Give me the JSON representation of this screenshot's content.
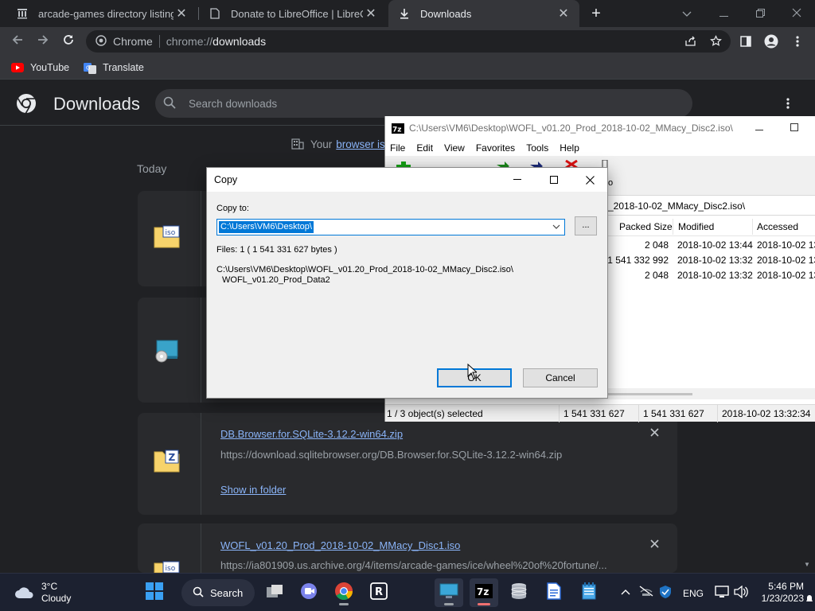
{
  "browser": {
    "tabs": [
      {
        "title": "arcade-games directory listing",
        "close": "✕"
      },
      {
        "title": "Donate to LibreOffice | LibreOffice",
        "close": "✕"
      },
      {
        "title": "Downloads",
        "close": "✕"
      }
    ],
    "new_tab": "+",
    "site_chip": "Chrome",
    "url_scheme": "chrome://",
    "url_host": "downloads",
    "bookmarks": [
      {
        "label": "YouTube"
      },
      {
        "label": "Translate"
      }
    ]
  },
  "downloads_page": {
    "title": "Downloads",
    "search_placeholder": "Search downloads",
    "managed_prefix": "Your",
    "managed_link": "browser is",
    "date_heading": "Today",
    "items": [
      {
        "name": "DB.Browser.for.SQLite-3.12.2-win64.zip",
        "url": "https://download.sqlitebrowser.org/DB.Browser.for.SQLite-3.12.2-win64.zip",
        "action": "Show in folder",
        "icon_label": "Z"
      },
      {
        "name": "WOFL_v01.20_Prod_2018-10-02_MMacy_Disc1.iso",
        "url": "https://ia801909.us.archive.org/4/items/arcade-games/ice/wheel%20of%20fortune/...",
        "icon_label": "iso"
      }
    ],
    "top_icon_labels": [
      "iso"
    ]
  },
  "sevenzip": {
    "title": "C:\\Users\\VM6\\Desktop\\WOFL_v01.20_Prod_2018-10-02_MMacy_Disc2.iso\\",
    "logo": "7z",
    "menu": [
      "File",
      "Edit",
      "View",
      "Favorites",
      "Tools",
      "Help"
    ],
    "toolbar_partial": "o",
    "path": "_2018-10-02_MMacy_Disc2.iso\\",
    "columns": [
      "Packed Size",
      "Modified",
      "Accessed"
    ],
    "rows": [
      {
        "packed": "2 048",
        "modified": "2018-10-02 13:44",
        "accessed": "2018-10-02 13"
      },
      {
        "packed": "1 541 332 992",
        "modified": "2018-10-02 13:32",
        "accessed": "2018-10-02 13"
      },
      {
        "packed": "2 048",
        "modified": "2018-10-02 13:32",
        "accessed": "2018-10-02 13"
      }
    ],
    "status": {
      "selected": "1 / 3 object(s) selected",
      "size": "1 541 331 627",
      "packed": "1 541 331 627",
      "date": "2018-10-02 13:32:34"
    }
  },
  "copy_dialog": {
    "title": "Copy",
    "copy_to_label": "Copy to:",
    "copy_to_value": "C:\\Users\\VM6\\Desktop\\",
    "browse_label": "...",
    "files_info": "Files: 1     ( 1 541 331 627 bytes )",
    "source_path_1": "C:\\Users\\VM6\\Desktop\\WOFL_v01.20_Prod_2018-10-02_MMacy_Disc2.iso\\",
    "source_path_2": "WOFL_v01.20_Prod_Data2",
    "ok_label": "OK",
    "cancel_label": "Cancel"
  },
  "taskbar": {
    "temperature": "3°C",
    "condition": "Cloudy",
    "search_label": "Search",
    "language": "ENG",
    "time": "5:46 PM",
    "date": "1/23/2023",
    "app_7zip_label": "7z"
  }
}
